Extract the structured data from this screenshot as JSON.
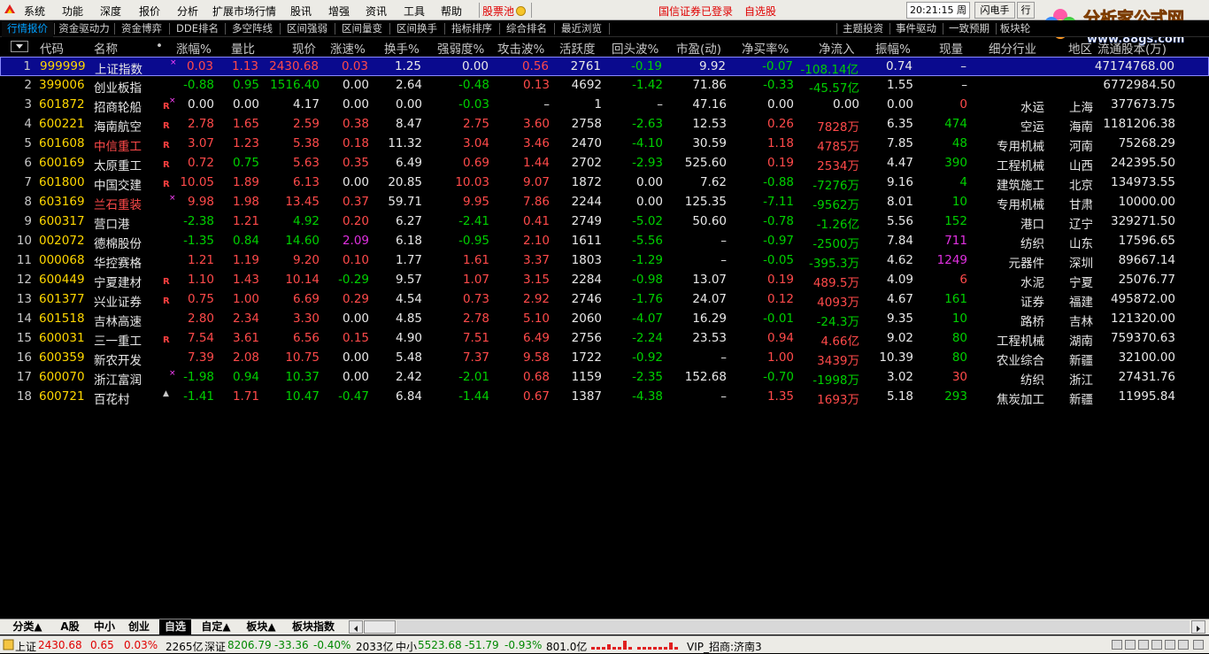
{
  "menubar": {
    "items": [
      "系统",
      "功能",
      "深度",
      "报价",
      "分析",
      "扩展市场行情",
      "股讯",
      "增强",
      "资讯",
      "工具",
      "帮助"
    ],
    "stock_pool": "股票池",
    "broker_login": "国信证券已登录",
    "self_select": "自选股",
    "clock": "20:21:15 周二",
    "flash_trade": "闪电手",
    "trade": "行"
  },
  "site_logo": {
    "title": "分析家公式网",
    "url": "www.88gs.com"
  },
  "tabs": [
    "行情报价",
    "资金驱动力",
    "资金博弈",
    "DDE排名",
    "多空阵线",
    "区间强弱",
    "区间量变",
    "区间换手",
    "指标排序",
    "综合排名",
    "最近浏览",
    "主题投资",
    "事件驱动",
    "一致预期",
    "板块轮"
  ],
  "columns": {
    "code": "代码",
    "name": "名称",
    "dot": "•",
    "change_pct": "涨幅%",
    "vol_ratio": "量比",
    "price": "现价",
    "speed": "涨速%",
    "turnover": "换手%",
    "strength": "强弱度%",
    "attack": "攻击波%",
    "activity": "活跃度",
    "pullback": "回头波%",
    "pe": "市盈(动)",
    "net_buy": "净买率%",
    "net_inflow": "净流入",
    "amplitude": "振幅%",
    "volume": "现量",
    "industry": "细分行业",
    "region": "地区",
    "float_shares": "流通股本(万)"
  },
  "rows": [
    {
      "no": "1",
      "code": "999999",
      "name": "上证指数",
      "mark": "x",
      "chg": "0.03",
      "vr": "1.13",
      "price": "2430.68",
      "spd": "0.03",
      "turn": "1.25",
      "str": "0.00",
      "atk": "0.56",
      "act": "2761",
      "pb": "-0.19",
      "pe": "9.92",
      "nb": "-0.07",
      "ni": "-108.14亿",
      "amp": "0.74",
      "vol": "–",
      "ind": "",
      "reg": "",
      "fs": "47174768.00"
    },
    {
      "no": "2",
      "code": "399006",
      "name": "创业板指",
      "mark": "",
      "chg": "-0.88",
      "vr": "0.95",
      "price": "1516.40",
      "spd": "0.00",
      "turn": "2.64",
      "str": "-0.48",
      "atk": "0.13",
      "act": "4692",
      "pb": "-1.42",
      "pe": "71.86",
      "nb": "-0.33",
      "ni": "-45.57亿",
      "amp": "1.55",
      "vol": "–",
      "ind": "",
      "reg": "",
      "fs": "6772984.50"
    },
    {
      "no": "3",
      "code": "601872",
      "name": "招商轮船",
      "mark": "Rx",
      "chg": "0.00",
      "vr": "0.00",
      "price": "4.17",
      "spd": "0.00",
      "turn": "0.00",
      "str": "-0.03",
      "atk": "–",
      "act": "1",
      "pb": "–",
      "pe": "47.16",
      "nb": "0.00",
      "ni": "0.00",
      "amp": "0.00",
      "vol": "0",
      "ind": "水运",
      "reg": "上海",
      "fs": "377673.75"
    },
    {
      "no": "4",
      "code": "600221",
      "name": "海南航空",
      "mark": "R",
      "chg": "2.78",
      "vr": "1.65",
      "price": "2.59",
      "spd": "0.38",
      "turn": "8.47",
      "str": "2.75",
      "atk": "3.60",
      "act": "2758",
      "pb": "-2.63",
      "pe": "12.53",
      "nb": "0.26",
      "ni": "7828万",
      "amp": "6.35",
      "vol": "474",
      "ind": "空运",
      "reg": "海南",
      "fs": "1181206.38"
    },
    {
      "no": "5",
      "code": "601608",
      "name": "中信重工",
      "mark": "R",
      "chg": "3.07",
      "vr": "1.23",
      "price": "5.38",
      "spd": "0.18",
      "turn": "11.32",
      "str": "3.04",
      "atk": "3.46",
      "act": "2470",
      "pb": "-4.10",
      "pe": "30.59",
      "nb": "1.18",
      "ni": "4785万",
      "amp": "7.85",
      "vol": "48",
      "ind": "专用机械",
      "reg": "河南",
      "fs": "75268.29"
    },
    {
      "no": "6",
      "code": "600169",
      "name": "太原重工",
      "mark": "R",
      "chg": "0.72",
      "vr": "0.75",
      "price": "5.63",
      "spd": "0.35",
      "turn": "6.49",
      "str": "0.69",
      "atk": "1.44",
      "act": "2702",
      "pb": "-2.93",
      "pe": "525.60",
      "nb": "0.19",
      "ni": "2534万",
      "amp": "4.47",
      "vol": "390",
      "ind": "工程机械",
      "reg": "山西",
      "fs": "242395.50"
    },
    {
      "no": "7",
      "code": "601800",
      "name": "中国交建",
      "mark": "R",
      "chg": "10.05",
      "vr": "1.89",
      "price": "6.13",
      "spd": "0.00",
      "turn": "20.85",
      "str": "10.03",
      "atk": "9.07",
      "act": "1872",
      "pb": "0.00",
      "pe": "7.62",
      "nb": "-0.88",
      "ni": "-7276万",
      "amp": "9.16",
      "vol": "4",
      "ind": "建筑施工",
      "reg": "北京",
      "fs": "134973.55"
    },
    {
      "no": "8",
      "code": "603169",
      "name": "兰石重装",
      "mark": "x",
      "chg": "9.98",
      "vr": "1.98",
      "price": "13.45",
      "spd": "0.37",
      "turn": "59.71",
      "str": "9.95",
      "atk": "7.86",
      "act": "2244",
      "pb": "0.00",
      "pe": "125.35",
      "nb": "-7.11",
      "ni": "-9562万",
      "amp": "8.01",
      "vol": "10",
      "ind": "专用机械",
      "reg": "甘肃",
      "fs": "10000.00"
    },
    {
      "no": "9",
      "code": "600317",
      "name": "营口港",
      "mark": "",
      "chg": "-2.38",
      "vr": "1.21",
      "price": "4.92",
      "spd": "0.20",
      "turn": "6.27",
      "str": "-2.41",
      "atk": "0.41",
      "act": "2749",
      "pb": "-5.02",
      "pe": "50.60",
      "nb": "-0.78",
      "ni": "-1.26亿",
      "amp": "5.56",
      "vol": "152",
      "ind": "港口",
      "reg": "辽宁",
      "fs": "329271.50"
    },
    {
      "no": "10",
      "code": "002072",
      "name": "德棉股份",
      "mark": "",
      "chg": "-1.35",
      "vr": "0.84",
      "price": "14.60",
      "spd": "2.09",
      "turn": "6.18",
      "str": "-0.95",
      "atk": "2.10",
      "act": "1611",
      "pb": "-5.56",
      "pe": "–",
      "nb": "-0.97",
      "ni": "-2500万",
      "amp": "7.84",
      "vol": "711",
      "ind": "纺织",
      "reg": "山东",
      "fs": "17596.65"
    },
    {
      "no": "11",
      "code": "000068",
      "name": "华控赛格",
      "mark": "",
      "chg": "1.21",
      "vr": "1.19",
      "price": "9.20",
      "spd": "0.10",
      "turn": "1.77",
      "str": "1.61",
      "atk": "3.37",
      "act": "1803",
      "pb": "-1.29",
      "pe": "–",
      "nb": "-0.05",
      "ni": "-395.3万",
      "amp": "4.62",
      "vol": "1249",
      "ind": "元器件",
      "reg": "深圳",
      "fs": "89667.14"
    },
    {
      "no": "12",
      "code": "600449",
      "name": "宁夏建材",
      "mark": "R",
      "chg": "1.10",
      "vr": "1.43",
      "price": "10.14",
      "spd": "-0.29",
      "turn": "9.57",
      "str": "1.07",
      "atk": "3.15",
      "act": "2284",
      "pb": "-0.98",
      "pe": "13.07",
      "nb": "0.19",
      "ni": "489.5万",
      "amp": "4.09",
      "vol": "6",
      "ind": "水泥",
      "reg": "宁夏",
      "fs": "25076.77"
    },
    {
      "no": "13",
      "code": "601377",
      "name": "兴业证券",
      "mark": "R",
      "chg": "0.75",
      "vr": "1.00",
      "price": "6.69",
      "spd": "0.29",
      "turn": "4.54",
      "str": "0.73",
      "atk": "2.92",
      "act": "2746",
      "pb": "-1.76",
      "pe": "24.07",
      "nb": "0.12",
      "ni": "4093万",
      "amp": "4.67",
      "vol": "161",
      "ind": "证券",
      "reg": "福建",
      "fs": "495872.00"
    },
    {
      "no": "14",
      "code": "601518",
      "name": "吉林高速",
      "mark": "",
      "chg": "2.80",
      "vr": "2.34",
      "price": "3.30",
      "spd": "0.00",
      "turn": "4.85",
      "str": "2.78",
      "atk": "5.10",
      "act": "2060",
      "pb": "-4.07",
      "pe": "16.29",
      "nb": "-0.01",
      "ni": "-24.3万",
      "amp": "9.35",
      "vol": "10",
      "ind": "路桥",
      "reg": "吉林",
      "fs": "121320.00"
    },
    {
      "no": "15",
      "code": "600031",
      "name": "三一重工",
      "mark": "R",
      "chg": "7.54",
      "vr": "3.61",
      "price": "6.56",
      "spd": "0.15",
      "turn": "4.90",
      "str": "7.51",
      "atk": "6.49",
      "act": "2756",
      "pb": "-2.24",
      "pe": "23.53",
      "nb": "0.94",
      "ni": "4.66亿",
      "amp": "9.02",
      "vol": "80",
      "ind": "工程机械",
      "reg": "湖南",
      "fs": "759370.63"
    },
    {
      "no": "16",
      "code": "600359",
      "name": "新农开发",
      "mark": "",
      "chg": "7.39",
      "vr": "2.08",
      "price": "10.75",
      "spd": "0.00",
      "turn": "5.48",
      "str": "7.37",
      "atk": "9.58",
      "act": "1722",
      "pb": "-0.92",
      "pe": "–",
      "nb": "1.00",
      "ni": "3439万",
      "amp": "10.39",
      "vol": "80",
      "ind": "农业综合",
      "reg": "新疆",
      "fs": "32100.00"
    },
    {
      "no": "17",
      "code": "600070",
      "name": "浙江富润",
      "mark": "x",
      "chg": "-1.98",
      "vr": "0.94",
      "price": "10.37",
      "spd": "0.00",
      "turn": "2.42",
      "str": "-2.01",
      "atk": "0.68",
      "act": "1159",
      "pb": "-2.35",
      "pe": "152.68",
      "nb": "-0.70",
      "ni": "-1998万",
      "amp": "3.02",
      "vol": "30",
      "ind": "纺织",
      "reg": "浙江",
      "fs": "27431.76"
    },
    {
      "no": "18",
      "code": "600721",
      "name": "百花村",
      "mark": "s",
      "chg": "-1.41",
      "vr": "1.71",
      "price": "10.47",
      "spd": "-0.47",
      "turn": "6.84",
      "str": "-1.44",
      "atk": "0.67",
      "act": "1387",
      "pb": "-4.38",
      "pe": "–",
      "nb": "1.35",
      "ni": "1693万",
      "amp": "5.18",
      "vol": "293",
      "ind": "焦炭加工",
      "reg": "新疆",
      "fs": "11995.84"
    }
  ],
  "bottom_tabs": [
    "分类▲",
    "A股",
    "中小",
    "创业",
    "自选",
    "自定▲",
    "板块▲",
    "板块指数"
  ],
  "statusbar": {
    "sh_label": "上证",
    "sh_value": "2430.68",
    "sh_chg": "0.65",
    "sh_pct": "0.03%",
    "sh_amount": "2265亿",
    "sz_label": "深证",
    "sz_value": "8206.79",
    "sz_chg": "-33.36",
    "sz_pct": "-0.40%",
    "sz_amount": "2033亿",
    "zx_label": "中小",
    "zx_value": "5523.68",
    "zx_chg": "-51.79",
    "zx_pct": "-0.93%",
    "zx_amount": "801.0亿",
    "vip": "VIP_招商:济南3"
  },
  "colors": {
    "up": "#ff4a4a",
    "down": "#00d000",
    "flat": "#e8e8e8",
    "code": "#ffd700",
    "selected": "#0a0a8e"
  }
}
